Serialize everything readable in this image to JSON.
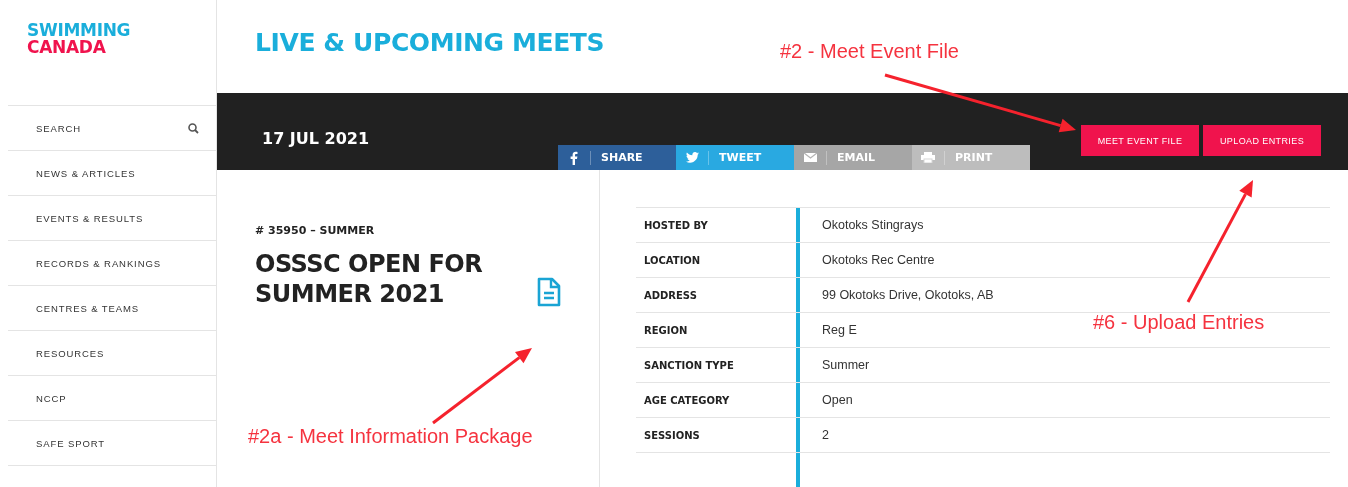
{
  "logo": {
    "line_1": "SWIMMING",
    "line_2": "CANADA"
  },
  "page_title": "LIVE & UPCOMING MEETS",
  "sidebar": {
    "items": [
      {
        "label": "SEARCH",
        "kind": "search"
      },
      {
        "label": "NEWS & ARTICLES",
        "kind": "link"
      },
      {
        "label": "EVENTS & RESULTS",
        "kind": "link"
      },
      {
        "label": "RECORDS & RANKINGS",
        "kind": "link"
      },
      {
        "label": "CENTRES & TEAMS",
        "kind": "link"
      },
      {
        "label": "RESOURCES",
        "kind": "link"
      },
      {
        "label": "NCCP",
        "kind": "link"
      },
      {
        "label": "SAFE SPORT",
        "kind": "link"
      }
    ]
  },
  "date": "17 JUL 2021",
  "actions": [
    "MEET EVENT FILE",
    "UPLOAD ENTRIES"
  ],
  "share": [
    {
      "label": "SHARE",
      "kind": "facebook"
    },
    {
      "label": "TWEET",
      "kind": "twitter"
    },
    {
      "label": "EMAIL",
      "kind": "email"
    },
    {
      "label": "PRINT",
      "kind": "print"
    }
  ],
  "meet": {
    "number": "# 35950 – SUMMER",
    "title": "OSSSC OPEN FOR SUMMER 2021"
  },
  "details": [
    {
      "label": "HOSTED BY",
      "value": "Okotoks Stingrays"
    },
    {
      "label": "LOCATION",
      "value": "Okotoks Rec Centre"
    },
    {
      "label": "ADDRESS",
      "value": "99 Okotoks Drive, Okotoks, AB"
    },
    {
      "label": "REGION",
      "value": "Reg E"
    },
    {
      "label": "SANCTION TYPE",
      "value": "Summer"
    },
    {
      "label": "AGE CATEGORY",
      "value": "Open"
    },
    {
      "label": "SESSIONS",
      "value": "2"
    }
  ],
  "annotations": [
    {
      "text": "#2 - Meet Event File"
    },
    {
      "text": "#6 - Upload Entries"
    },
    {
      "text": "#2a - Meet Information Package"
    }
  ]
}
